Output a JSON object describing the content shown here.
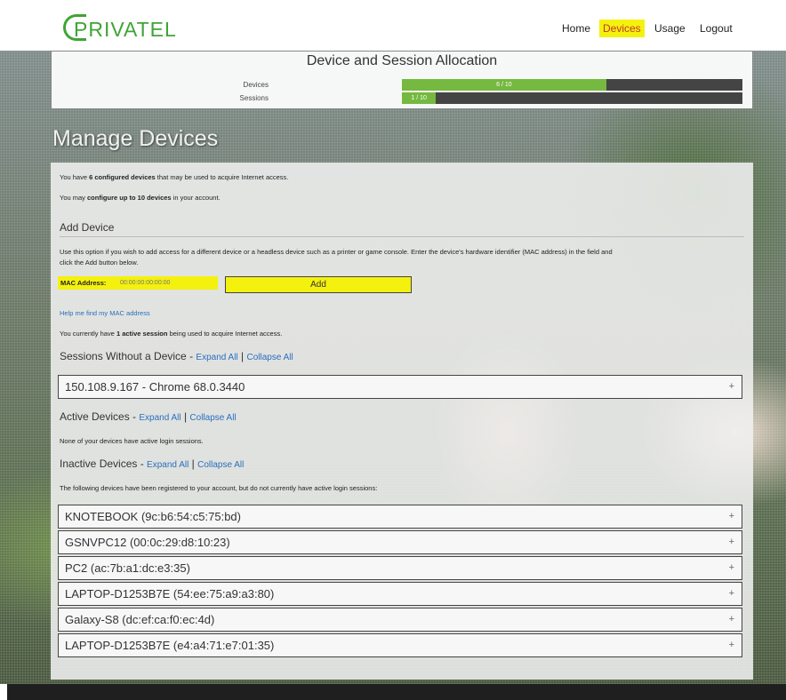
{
  "header": {
    "logo_text": "PRIVATEL",
    "nav": [
      {
        "label": "Home",
        "active": false
      },
      {
        "label": "Devices",
        "active": true
      },
      {
        "label": "Usage",
        "active": false
      },
      {
        "label": "Logout",
        "active": false
      }
    ]
  },
  "allocation": {
    "title": "Device and Session Allocation",
    "devices": {
      "label": "Devices",
      "text": "6 / 10",
      "fraction": 0.6
    },
    "sessions": {
      "label": "Sessions",
      "text": "1 / 10",
      "fraction": 0.1
    }
  },
  "page_title": "Manage Devices",
  "intro": {
    "line1_pre": "You have ",
    "line1_bold": "6 configured devices",
    "line1_post": " that may be used to acquire Internet access.",
    "line2_pre": "You may ",
    "line2_bold": "configure up to 10 devices",
    "line2_post": " in your account."
  },
  "add_device": {
    "heading": "Add Device",
    "desc_line1": "Use this option if you wish to add access for a different device or a headless device such as a printer or game console. Enter the device's hardware identifier (MAC address) in the field and",
    "desc_line2": "click the Add button below.",
    "mac_label": "MAC Address:",
    "mac_placeholder": "00:00:00:00:00:00",
    "add_button": "Add",
    "help_link": "Help me find my MAC address"
  },
  "session_info": {
    "pre": "You currently have ",
    "bold": "1 active session",
    "post": " being used to acquire Internet access."
  },
  "sessions_without_device": {
    "heading": "Sessions Without a Device - ",
    "expand": "Expand All",
    "separator": " | ",
    "collapse": "Collapse All",
    "items": [
      "150.108.9.167 - Chrome 68.0.3440"
    ]
  },
  "active_devices": {
    "heading": "Active Devices - ",
    "expand": "Expand All",
    "separator": " | ",
    "collapse": "Collapse All",
    "note": "None of your devices have active login sessions."
  },
  "inactive_devices": {
    "heading": "Inactive Devices - ",
    "expand": "Expand All",
    "separator": " | ",
    "collapse": "Collapse All",
    "note": "The following devices have been registered to your account, but do not currently have active login sessions:",
    "items": [
      "KNOTEBOOK (9c:b6:54:c5:75:bd)",
      "GSNVPC12 (00:0c:29:d8:10:23)",
      "PC2 (ac:7b:a1:dc:e3:35)",
      "LAPTOP-D1253B7E (54:ee:75:a9:a3:80)",
      "Galaxy-S8 (dc:ef:ca:f0:ec:4d)",
      "LAPTOP-D1253B7E (e4:a4:71:e7:01:35)"
    ]
  },
  "accordion_icon": "+",
  "colors": {
    "brand_green": "#3fa535",
    "bar_fill": "#75b940",
    "highlight": "#f4f10e",
    "link": "#2a6fbf"
  }
}
